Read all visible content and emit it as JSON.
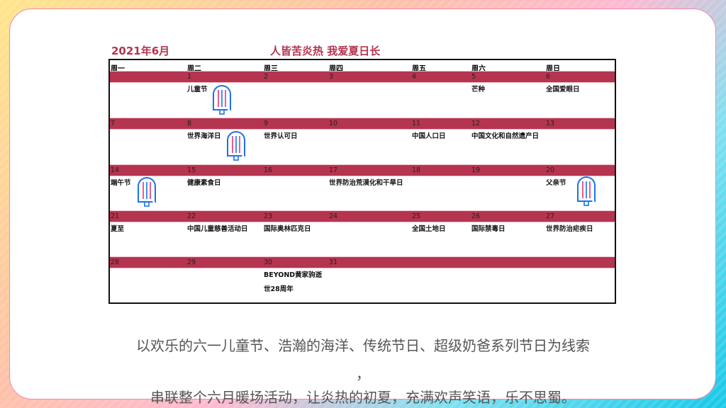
{
  "header": {
    "month": "2021年6月",
    "slogan": "人皆苦炎热 我爱夏日长"
  },
  "weekdays": [
    "周一",
    "周二",
    "周三",
    "周四",
    "周五",
    "周六",
    "周日"
  ],
  "weeks": [
    [
      {
        "d": "",
        "e": ""
      },
      {
        "d": "1",
        "e": "儿童节"
      },
      {
        "d": "2",
        "e": ""
      },
      {
        "d": "3",
        "e": ""
      },
      {
        "d": "4",
        "e": ""
      },
      {
        "d": "5",
        "e": "芒种"
      },
      {
        "d": "6",
        "e": "全国爱眼日"
      }
    ],
    [
      {
        "d": "7",
        "e": ""
      },
      {
        "d": "8",
        "e": "世界海洋日"
      },
      {
        "d": "9",
        "e": "世界认可日"
      },
      {
        "d": "10",
        "e": ""
      },
      {
        "d": "11",
        "e": "中国人口日"
      },
      {
        "d": "12",
        "e": "中国文化和自然遗产日"
      },
      {
        "d": "13",
        "e": ""
      }
    ],
    [
      {
        "d": "14",
        "e": "端午节"
      },
      {
        "d": "15",
        "e": "健康素食日"
      },
      {
        "d": "16",
        "e": ""
      },
      {
        "d": "17",
        "e": "世界防治荒漠化和干旱日"
      },
      {
        "d": "18",
        "e": ""
      },
      {
        "d": "19",
        "e": ""
      },
      {
        "d": "20",
        "e": "父亲节"
      }
    ],
    [
      {
        "d": "21",
        "e": "夏至"
      },
      {
        "d": "22",
        "e": "中国儿童慈善活动日"
      },
      {
        "d": "23",
        "e": "国际奥林匹克日"
      },
      {
        "d": "24",
        "e": ""
      },
      {
        "d": "25",
        "e": "全国土地日"
      },
      {
        "d": "26",
        "e": "国际禁毒日"
      },
      {
        "d": "27",
        "e": "世界防治疟疾日"
      }
    ],
    [
      {
        "d": "28",
        "e": ""
      },
      {
        "d": "29",
        "e": ""
      },
      {
        "d": "30",
        "e": "BEYOND黄家驹逝\n世28周年"
      },
      {
        "d": "31",
        "e": ""
      },
      {
        "d": "",
        "e": ""
      },
      {
        "d": "",
        "e": ""
      },
      {
        "d": "",
        "e": ""
      }
    ]
  ],
  "caption": {
    "line1": "以欢乐的六一儿童节、浩瀚的海洋、传统节日、超级奶爸系列节日为线索",
    "line2": "，",
    "line3": "串联整个六月暖场活动，让炎热的初夏，充满欢声笑语，乐不思蜀。"
  },
  "colors": {
    "accent": "#b5344f",
    "popsicle_outline": "#1a73e8",
    "popsicle_stripe": "#e8337a"
  }
}
